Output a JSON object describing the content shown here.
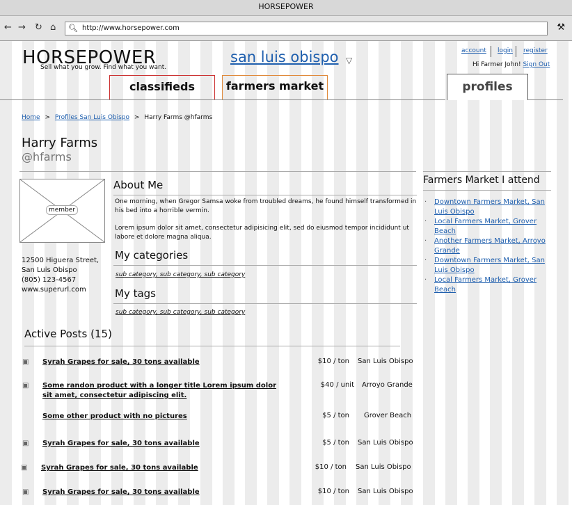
{
  "window": {
    "title": "HORSEPOWER"
  },
  "browser": {
    "url": "http://www.horsepower.com"
  },
  "site": {
    "logo": "HORSEPOWER",
    "tagline": "Sell what you grow. Find what you want.",
    "city": "san luis obispo"
  },
  "account_links": {
    "account": "account",
    "login": "login",
    "register": "register",
    "greeting": "Hi Farmer John!",
    "signout": "Sign Out"
  },
  "tabs": {
    "classifieds": "classifieds",
    "farmers_market": "farmers market",
    "profiles": "profiles"
  },
  "breadcrumb": {
    "home": "Home",
    "sep1": ">",
    "profiles": "Profiles San Luis Obispo",
    "sep2": ">",
    "current": "Harry Farms @hfarms"
  },
  "profile": {
    "name": "Harry Farms",
    "handle": "@hfarms",
    "image_label": "member",
    "address_line1": "12500 Higuera Street,",
    "address_line2": "San Luis Obispo",
    "phone": "(805) 123-4567",
    "website": "www.superurl.com"
  },
  "about": {
    "title": "About Me",
    "p1": "One morning, when Gregor Samsa woke from troubled dreams, he found himself transformed in his bed into a horrible vermin.",
    "p2": "Lorem ipsum dolor sit amet, consectetur adipisicing elit, sed do eiusmod tempor incididunt ut labore et dolore magna aliqua."
  },
  "categories": {
    "title": "My categories",
    "items": "sub category, sub category, sub category"
  },
  "tags": {
    "title": "My tags",
    "items": "sub category, sub category, sub category"
  },
  "farmers_markets": {
    "title": "Farmers Market I attend",
    "items": [
      "Downtown Farmers Market, San Luis Obispo",
      "Local Farmers Market, Grover Beach",
      "Another Farmers Market, Arroyo Grande",
      "Downtown Farmers Market, San Luis Obispo",
      "Local Farmers Market, Grover Beach"
    ]
  },
  "posts": {
    "title": "Active Posts (15)",
    "items": [
      {
        "title": "Syrah Grapes for sale, 30 tons available",
        "price": "$10 / ton",
        "location": "San Luis Obispo",
        "has_photo": true
      },
      {
        "title": "Some randon product with a longer title Lorem ipsum dolor sit amet, consectetur adipiscing elit.",
        "price": "$40 / unit",
        "location": "Arroyo Grande",
        "has_photo": true
      },
      {
        "title": "Some other product with no pictures",
        "price": "$5 / ton",
        "location": "Grover Beach",
        "has_photo": false
      },
      {
        "title": "Syrah Grapes for sale, 30 tons available",
        "price": "$5 / ton",
        "location": "San Luis Obispo",
        "has_photo": true
      },
      {
        "title": "Syrah Grapes for sale, 30 tons available",
        "price": "$10 / ton",
        "location": "San Luis Obispo",
        "has_photo": true
      },
      {
        "title": "Syrah Grapes for sale, 30 tons available",
        "price": "$10 / ton",
        "location": "San Luis Obispo",
        "has_photo": true
      }
    ]
  },
  "icons": {
    "back": "back-arrow-icon",
    "forward": "forward-arrow-icon",
    "reload": "reload-icon",
    "home": "home-icon",
    "search": "search-icon",
    "wrench": "wrench-icon",
    "camera": "camera-icon",
    "dropdown": "dropdown-triangle-icon"
  },
  "colors": {
    "link": "#1f5fae",
    "classifieds_tab": "#cc3333",
    "farmers_tab": "#e08a3a"
  }
}
